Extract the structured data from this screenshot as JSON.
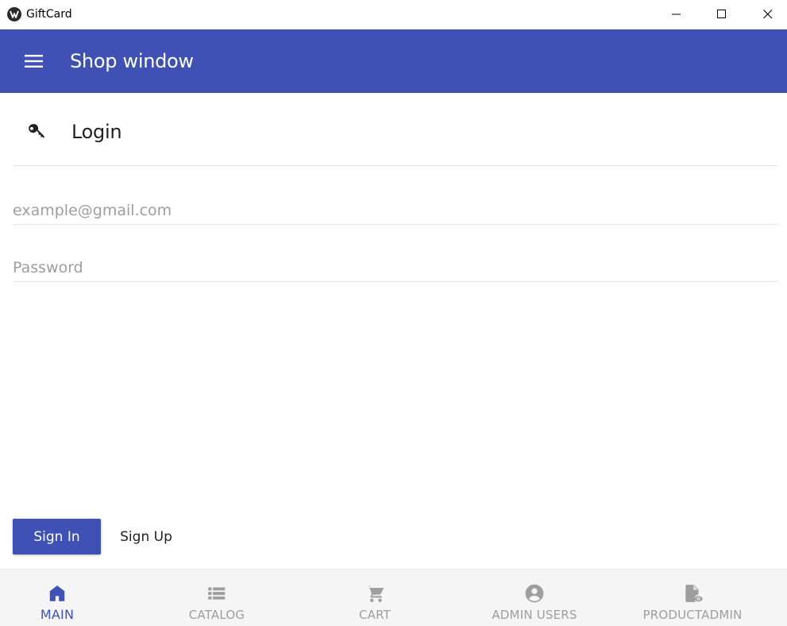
{
  "window": {
    "title": "GiftCard"
  },
  "appbar": {
    "title": "Shop window",
    "menu_icon": "menu-icon"
  },
  "login": {
    "title": "Login",
    "icon": "key-icon",
    "email_placeholder": "example@gmail.com",
    "email_value": "",
    "password_placeholder": "Password",
    "password_value": "",
    "signin_label": "Sign In",
    "signup_label": "Sign Up"
  },
  "bottom_nav": {
    "items": [
      {
        "label": "MAIN",
        "icon": "home-icon",
        "active": true
      },
      {
        "label": "CATALOG",
        "icon": "list-icon",
        "active": false
      },
      {
        "label": "CART",
        "icon": "cart-icon",
        "active": false
      },
      {
        "label": "ADMIN USERS",
        "icon": "account-circle-icon",
        "active": false
      },
      {
        "label": "PRODUCTADMIN",
        "icon": "file-eye-icon",
        "active": false
      }
    ]
  },
  "colors": {
    "primary": "#3f51b5",
    "inactive": "#9e9e9e",
    "nav_background": "#f5f5f5"
  }
}
